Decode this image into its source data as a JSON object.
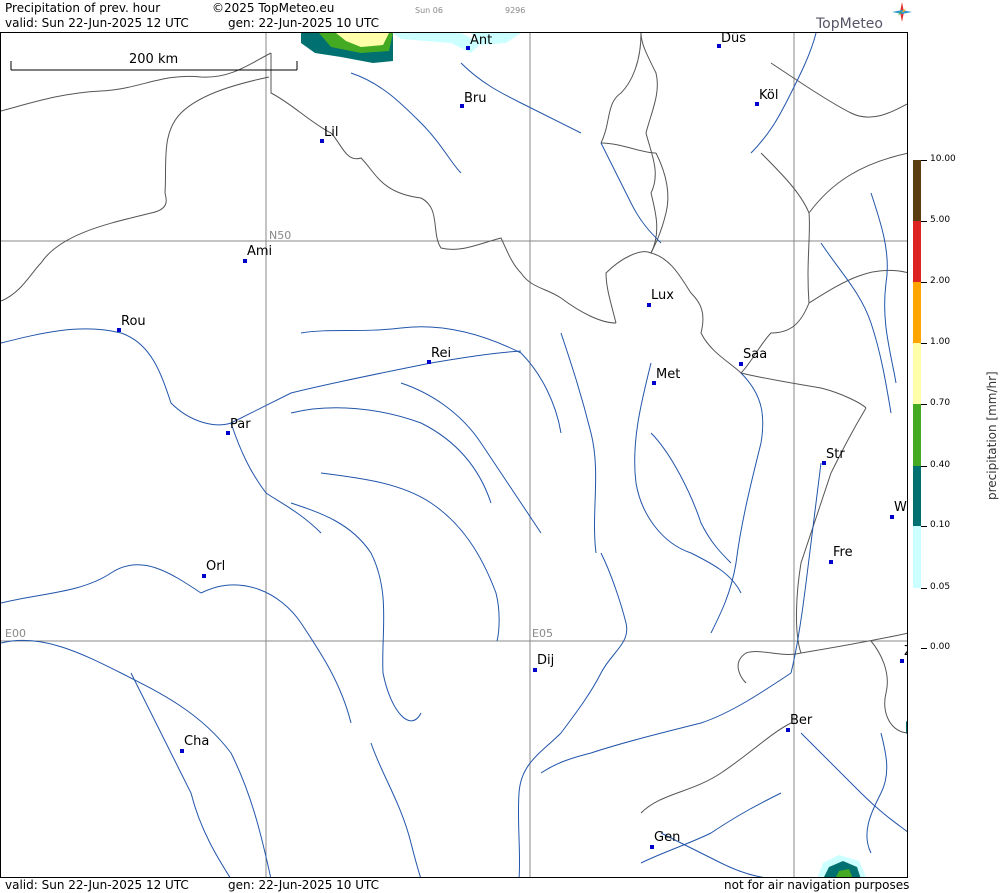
{
  "header": {
    "title": "Precipitation of prev. hour",
    "copyright": "©2025 TopMeteo.eu",
    "run_label": "Sun 06",
    "run_code": "9296",
    "valid": "valid:  Sun  22-Jun-2025  12 UTC",
    "gen": "gen: 22-Jun-2025 10 UTC",
    "logo": "TopMeteo"
  },
  "scale_bar": {
    "label": "200 km"
  },
  "grid_labels": {
    "n50": "N50",
    "e00": "E00",
    "e05": "E05"
  },
  "cities": [
    {
      "name": "Ant"
    },
    {
      "name": "Düs"
    },
    {
      "name": "Bru"
    },
    {
      "name": "Köl"
    },
    {
      "name": "Lil"
    },
    {
      "name": "Ami"
    },
    {
      "name": "Lux"
    },
    {
      "name": "Rou"
    },
    {
      "name": "Rei"
    },
    {
      "name": "Saa"
    },
    {
      "name": "Met"
    },
    {
      "name": "Par"
    },
    {
      "name": "Str"
    },
    {
      "name": "W"
    },
    {
      "name": "Fre"
    },
    {
      "name": "Orl"
    },
    {
      "name": "Dij"
    },
    {
      "name": "Z"
    },
    {
      "name": "Ber"
    },
    {
      "name": "Cha"
    },
    {
      "name": "Gen"
    }
  ],
  "legend": {
    "title": "precipitation [mm/hr]",
    "levels": [
      "10.00",
      "5.00",
      "2.00",
      "1.00",
      "0.70",
      "0.40",
      "0.10",
      "0.05",
      "0.00"
    ],
    "colors": {
      "above_5": "#5a3d10",
      "2_to_5": "#dd2222",
      "1_to_2": "#ffa500",
      "0_7_to_1": "#ffffaa",
      "0_4_to_0_7": "#44aa22",
      "0_1_to_0_4": "#007070",
      "0_05_to_0_1": "#ccffff"
    }
  },
  "footer": {
    "valid": "valid:  Sun  22-Jun-2025  12 UTC",
    "gen": "gen: 22-Jun-2025 10 UTC",
    "disclaimer": "not for air navigation purposes"
  }
}
